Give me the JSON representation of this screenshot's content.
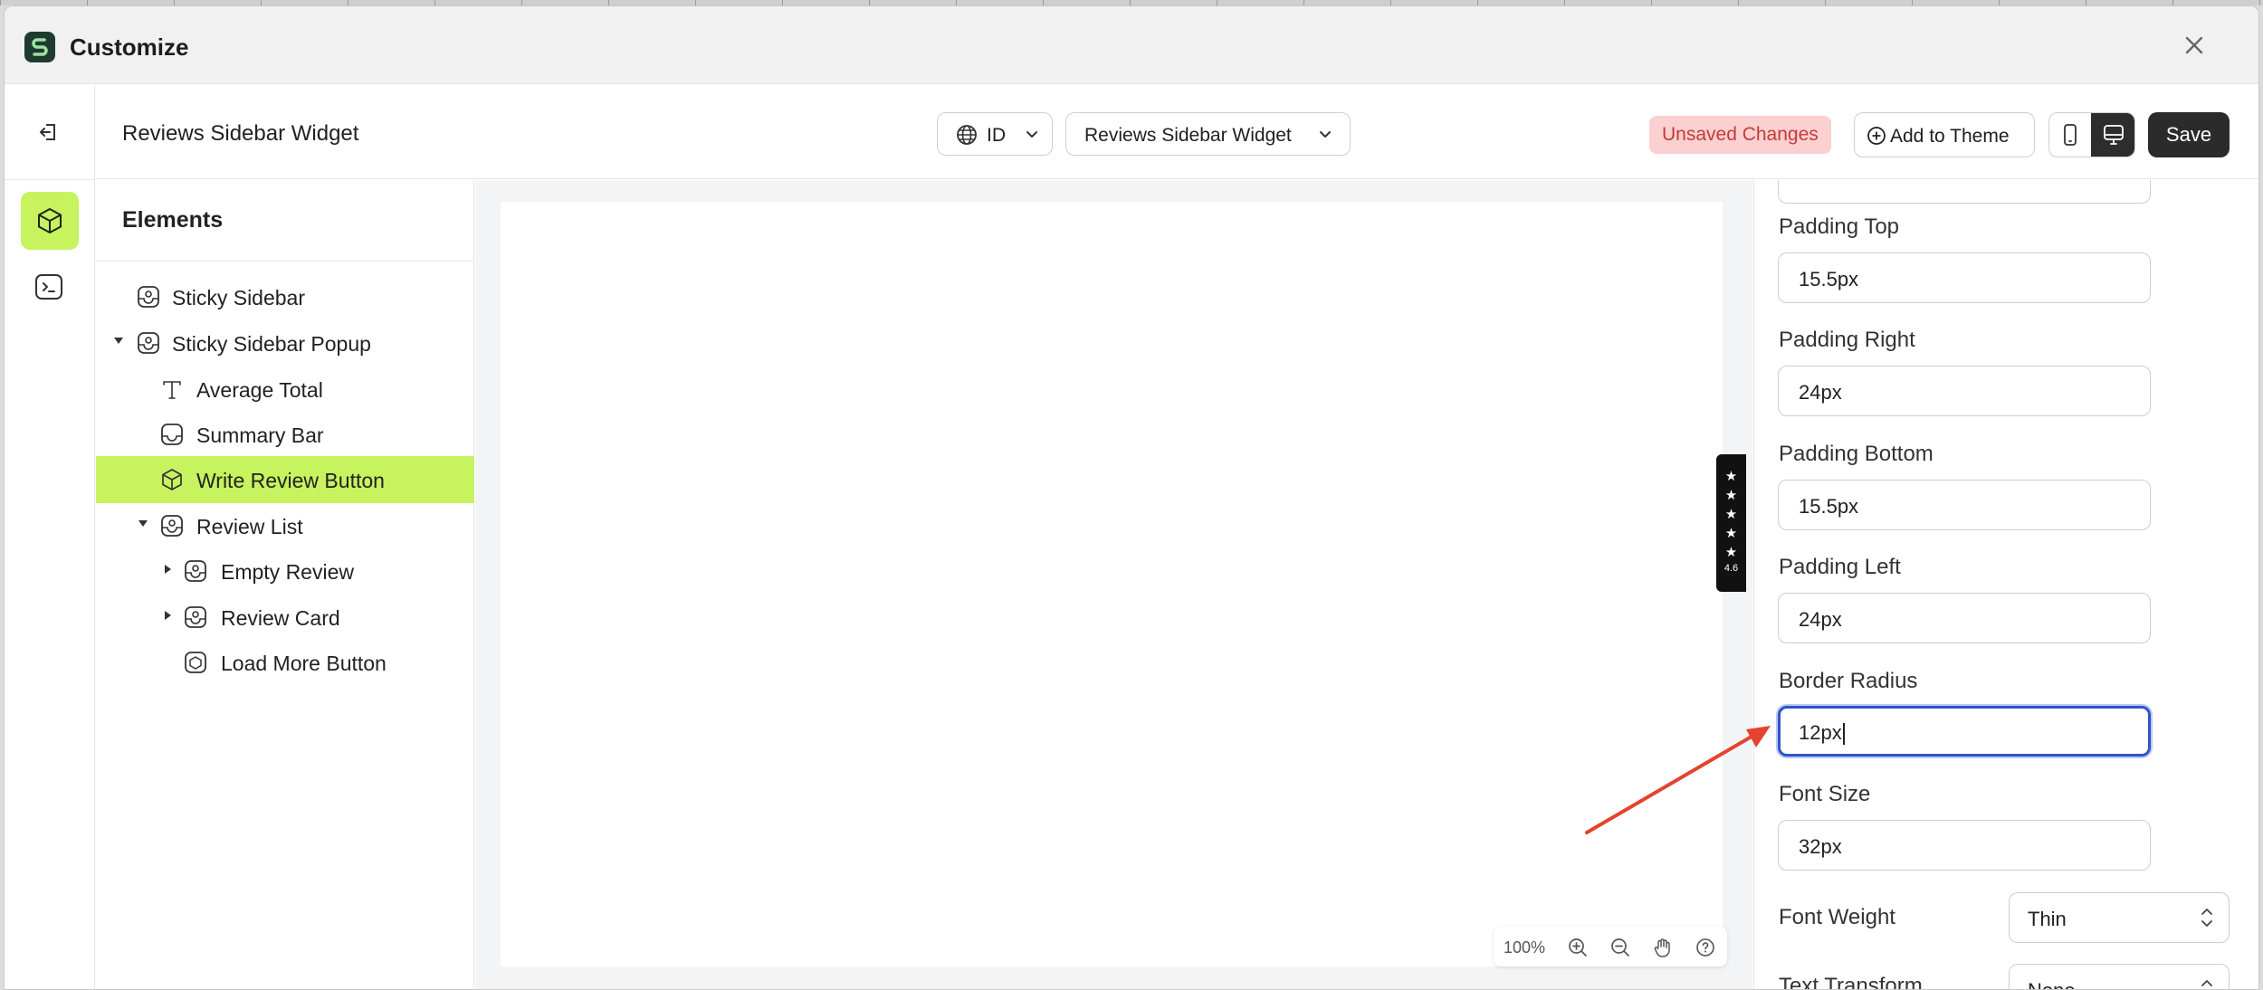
{
  "window": {
    "title": "Customize"
  },
  "header": {
    "widget_title": "Reviews Sidebar Widget",
    "language": "ID",
    "page": "Reviews Sidebar Widget",
    "unsaved_badge": "Unsaved Changes",
    "add_to_theme": "Add to Theme",
    "save": "Save"
  },
  "tree": {
    "heading": "Elements",
    "items": [
      {
        "label": "Sticky Sidebar",
        "icon": "section-icon"
      },
      {
        "label": "Sticky Sidebar Popup",
        "icon": "section-icon"
      },
      {
        "label": "Average Total",
        "icon": "text-icon"
      },
      {
        "label": "Summary Bar",
        "icon": "summary-bar-icon"
      },
      {
        "label": "Write Review Button",
        "icon": "cube-icon",
        "selected": true
      },
      {
        "label": "Review List",
        "icon": "section-icon"
      },
      {
        "label": "Empty Review",
        "icon": "section-icon"
      },
      {
        "label": "Review Card",
        "icon": "section-icon"
      },
      {
        "label": "Load More Button",
        "icon": "button-icon"
      }
    ]
  },
  "canvas": {
    "rating_score": "4.6",
    "zoom": "100%"
  },
  "props": {
    "padding_top": {
      "label": "Padding Top",
      "value": "15.5px"
    },
    "padding_right": {
      "label": "Padding Right",
      "value": "24px"
    },
    "padding_bottom": {
      "label": "Padding Bottom",
      "value": "15.5px"
    },
    "padding_left": {
      "label": "Padding Left",
      "value": "24px"
    },
    "border_radius": {
      "label": "Border Radius",
      "value": "12px"
    },
    "font_size": {
      "label": "Font Size",
      "value": "32px"
    },
    "font_weight": {
      "label": "Font Weight",
      "value": "Thin"
    },
    "text_transform": {
      "label": "Text Transform",
      "value": "None"
    }
  },
  "colors": {
    "accent": "#c6f35e",
    "unsaved_bg": "#fbd0d0",
    "unsaved_text": "#c43a3a",
    "focus_border": "#2e55c9",
    "annotation_arrow": "#e5432f"
  }
}
